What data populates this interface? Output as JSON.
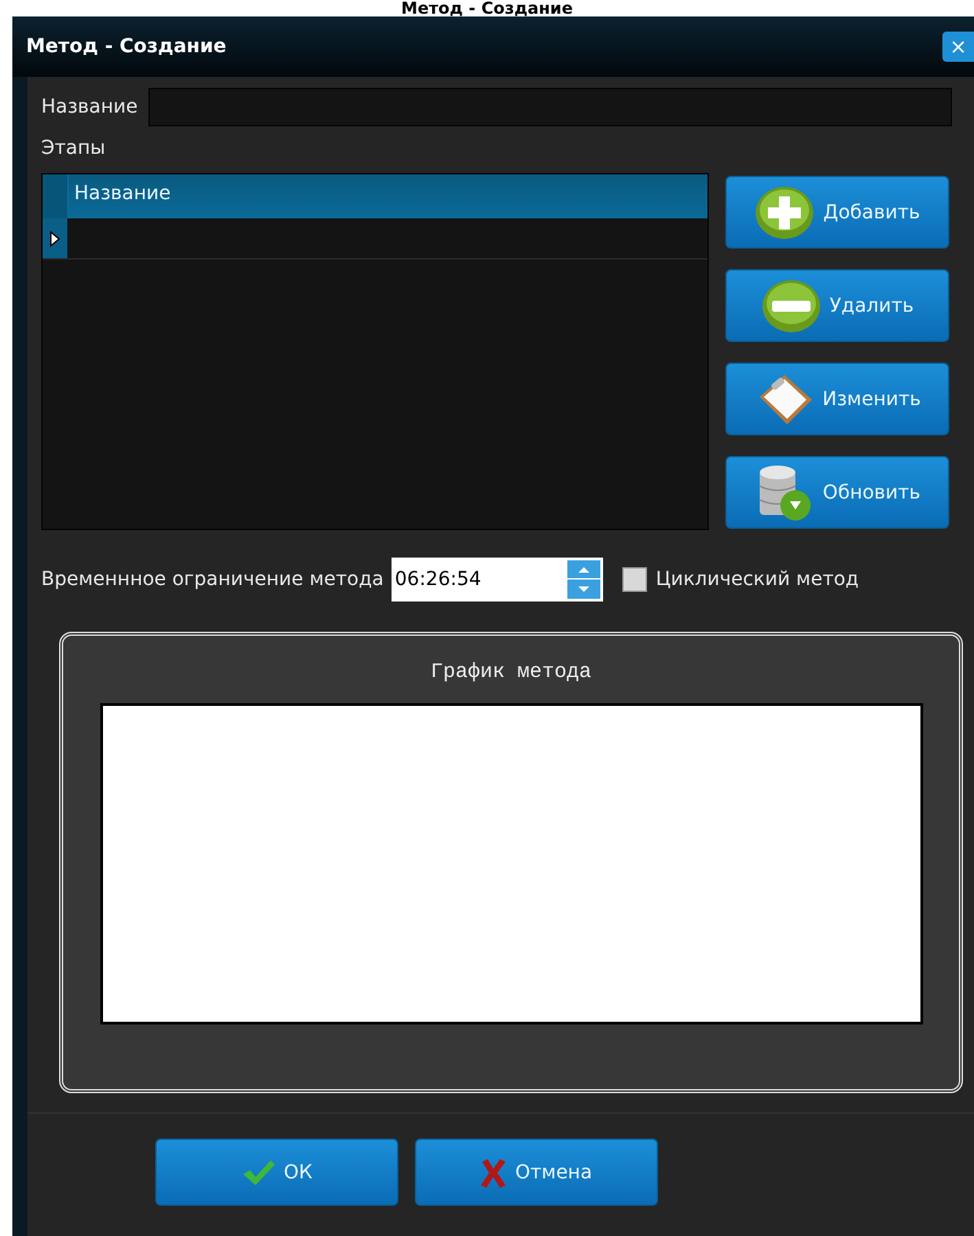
{
  "page_heading": "Метод - Создание",
  "window": {
    "title": "Метод - Создание",
    "close": "×"
  },
  "name_field": {
    "label": "Название"
  },
  "stages": {
    "label": "Этапы",
    "columns": [
      "Название"
    ],
    "rows": [
      {
        "current": true
      }
    ]
  },
  "side_buttons": [
    {
      "kind": "add",
      "label": "Добавить"
    },
    {
      "kind": "remove",
      "label": "Удалить"
    },
    {
      "kind": "edit",
      "label": "Изменить"
    },
    {
      "kind": "refresh",
      "label": "Обновить"
    }
  ],
  "time_limit": {
    "label": "Временнное ограничение метода",
    "value": "06:26:54"
  },
  "cyclic": {
    "label": "Циклический метод",
    "checked": false
  },
  "chart_panel": {
    "title": "График метода"
  },
  "footer_buttons": [
    {
      "kind": "ok",
      "label": "ОК"
    },
    {
      "kind": "cancel",
      "label": "Отмена"
    }
  ]
}
